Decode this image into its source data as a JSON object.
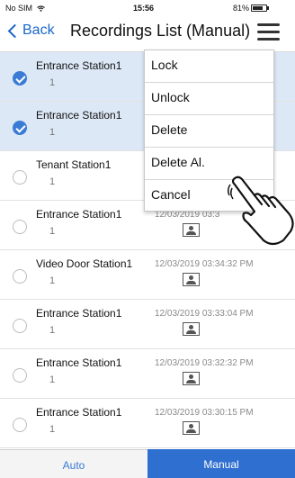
{
  "status": {
    "carrier": "No SIM",
    "time": "15:56",
    "battery_text": "81%",
    "battery_level": 0.81
  },
  "nav": {
    "back_label": "Back",
    "title": "Recordings List (Manual)"
  },
  "rows": [
    {
      "station": "Entrance Station1",
      "unit": "1",
      "timestamp": "",
      "selected": true
    },
    {
      "station": "Entrance Station1",
      "unit": "1",
      "timestamp": "",
      "selected": true
    },
    {
      "station": "Tenant Station1",
      "unit": "1",
      "timestamp": "",
      "selected": false
    },
    {
      "station": "Entrance Station1",
      "unit": "1",
      "timestamp": "12/03/2019 03:3",
      "selected": false
    },
    {
      "station": "Video Door Station1",
      "unit": "1",
      "timestamp": "12/03/2019 03:34:32 PM",
      "selected": false
    },
    {
      "station": "Entrance Station1",
      "unit": "1",
      "timestamp": "12/03/2019 03:33:04 PM",
      "selected": false
    },
    {
      "station": "Entrance Station1",
      "unit": "1",
      "timestamp": "12/03/2019 03:32:32 PM",
      "selected": false
    },
    {
      "station": "Entrance Station1",
      "unit": "1",
      "timestamp": "12/03/2019 03:30:15 PM",
      "selected": false
    }
  ],
  "menu": {
    "items": [
      "Lock",
      "Unlock",
      "Delete",
      "Delete Al.",
      "Cancel"
    ]
  },
  "tabs": {
    "auto": "Auto",
    "manual": "Manual",
    "active": "manual"
  },
  "colors": {
    "accent": "#2f6fd0",
    "selected_row": "#dde8f6",
    "link": "#1a66c9"
  },
  "icons": {
    "wifi": "wifi-icon",
    "battery": "battery-icon",
    "back": "chevron-left-icon",
    "menu": "hamburger-menu-icon",
    "checkbox": "radio-check-icon",
    "photo": "photo-icon",
    "pointer": "pointing-hand-icon"
  }
}
